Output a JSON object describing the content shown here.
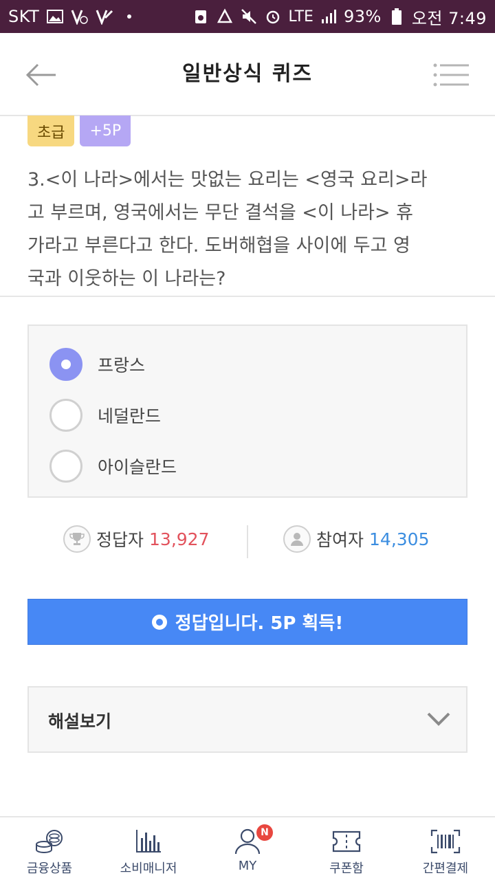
{
  "status_bar": {
    "carrier": "SKT",
    "network": "LTE",
    "battery": "93%",
    "time": "오전 7:49"
  },
  "header": {
    "title": "일반상식 퀴즈",
    "back_icon": "arrow-left-icon",
    "menu_icon": "hamburger-menu-icon"
  },
  "quiz": {
    "level_badge": "초급",
    "point_badge": "+5P",
    "question_lines": [
      "3.<이 나라>에서는 맛없는 요리는 <영국 요리>라",
      "고 부르며, 영국에서는 무단 결석을 <이 나라> 휴",
      "가라고 부른다고 한다. 도버해협을 사이에 두고 영",
      "국과 이웃하는 이 나라는?"
    ],
    "options": [
      {
        "label": "프랑스",
        "selected": true
      },
      {
        "label": "네덜란드",
        "selected": false
      },
      {
        "label": "아이슬란드",
        "selected": false
      }
    ]
  },
  "stats": {
    "correct_label": "정답자",
    "correct_value": "13,927",
    "participants_label": "참여자",
    "participants_value": "14,305"
  },
  "result": {
    "message": "정답입니다. 5P 획득!",
    "color": "#4788f5"
  },
  "explanation": {
    "label": "해설보기"
  },
  "bottom_nav": {
    "items": [
      {
        "label": "금융상품",
        "icon": "coins-icon"
      },
      {
        "label": "소비매니저",
        "icon": "bar-chart-icon"
      },
      {
        "label": "MY",
        "icon": "user-icon",
        "badge": "N"
      },
      {
        "label": "쿠폰함",
        "icon": "ticket-icon"
      },
      {
        "label": "간편결제",
        "icon": "barcode-icon"
      }
    ]
  },
  "colors": {
    "status_bar": "#4a1f3d",
    "accent_purple": "#8b93f2",
    "correct_red": "#e2525c",
    "participant_blue": "#3b8de0"
  }
}
